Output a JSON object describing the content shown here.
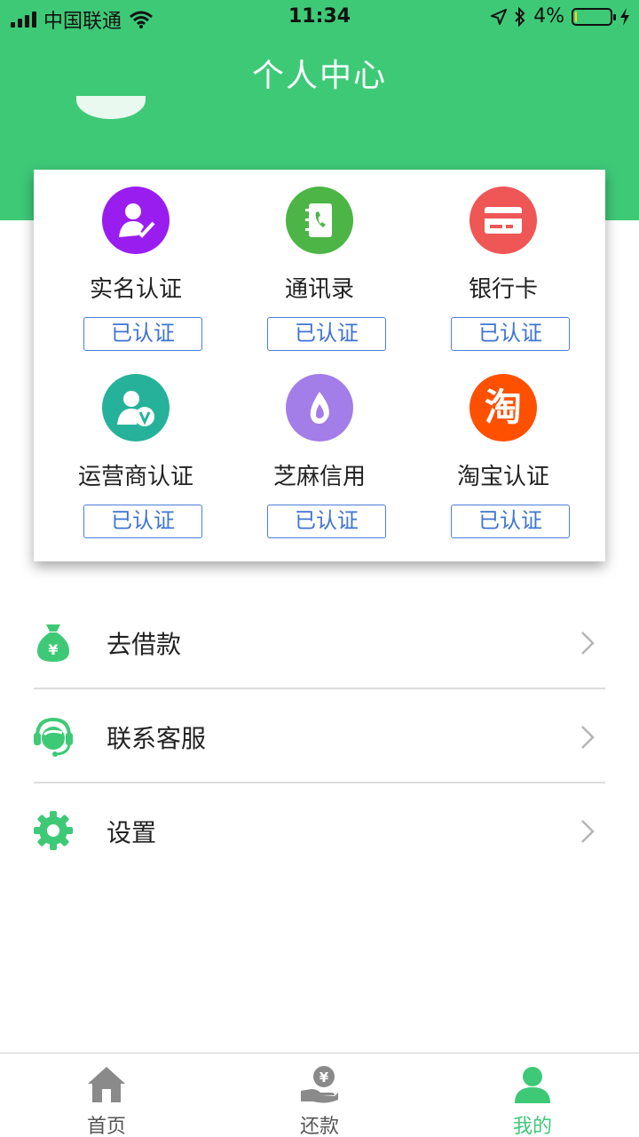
{
  "status_bar": {
    "carrier": "中国联通",
    "time": "11:34",
    "battery_percent": "4%",
    "battery_level": 0.04,
    "icons": [
      "signal-icon",
      "wifi-icon",
      "location-icon",
      "bluetooth-icon",
      "battery-icon",
      "charging-icon"
    ]
  },
  "header": {
    "title": "个人中心",
    "background_color": "#3ec977"
  },
  "verification": [
    {
      "label": "实名认证",
      "status": "已认证",
      "icon": "id-verify-icon",
      "color": "#9a1df0"
    },
    {
      "label": "通讯录",
      "status": "已认证",
      "icon": "contacts-icon",
      "color": "#4cb545"
    },
    {
      "label": "银行卡",
      "status": "已认证",
      "icon": "bank-card-icon",
      "color": "#ef5656"
    },
    {
      "label": "运营商认证",
      "status": "已认证",
      "icon": "carrier-icon",
      "color": "#26b29a"
    },
    {
      "label": "芝麻信用",
      "status": "已认证",
      "icon": "sesame-credit-icon",
      "color": "#a37de8"
    },
    {
      "label": "淘宝认证",
      "status": "已认证",
      "icon": "taobao-icon",
      "color": "#ff5000",
      "icon_text": "淘"
    }
  ],
  "menu": [
    {
      "label": "去借款",
      "icon": "money-bag-icon"
    },
    {
      "label": "联系客服",
      "icon": "customer-service-icon"
    },
    {
      "label": "设置",
      "icon": "gear-icon"
    }
  ],
  "tabbar": {
    "tabs": [
      {
        "label": "首页",
        "icon": "home-icon",
        "active": false
      },
      {
        "label": "还款",
        "icon": "repay-icon",
        "active": false
      },
      {
        "label": "我的",
        "icon": "user-icon",
        "active": true
      }
    ],
    "active_color": "#3ec977"
  }
}
